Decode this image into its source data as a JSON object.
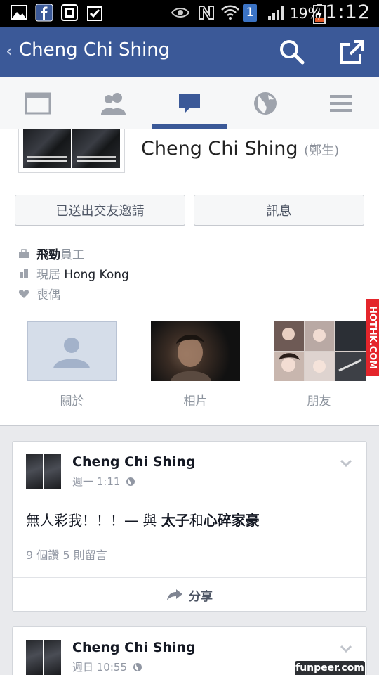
{
  "status_bar": {
    "battery_percent": "19%",
    "time": "1:12",
    "notification_badge": "1"
  },
  "header": {
    "back_label": "‹",
    "title": "Cheng Chi Shing"
  },
  "profile": {
    "name": "Cheng Chi Shing",
    "nickname": "(鄭生)",
    "friend_request_button": "已送出交友邀請",
    "message_button": "訊息",
    "work_company": "飛勁",
    "work_role": "員工",
    "lives_prefix": "現居",
    "lives_city": "Hong Kong",
    "relationship": "喪偶",
    "thumbnails": [
      {
        "label": "關於"
      },
      {
        "label": "相片"
      },
      {
        "label": "朋友"
      }
    ]
  },
  "posts": [
    {
      "author": "Cheng Chi Shing",
      "time": "週一 1:11",
      "text_main": "無人彩我！！！— 與 ",
      "tag1": "太子",
      "joiner": "和",
      "tag2": "心碎家豪",
      "stats": "9 個讚  5 則留言",
      "share_label": "分享"
    },
    {
      "author": "Cheng Chi Shing",
      "time": "週日 10:55"
    }
  ],
  "watermarks": {
    "side": "HOTHK.COM",
    "bottom": "funpeer.com"
  },
  "colors": {
    "brand": "#3b5998",
    "background": "#e9eaed"
  }
}
